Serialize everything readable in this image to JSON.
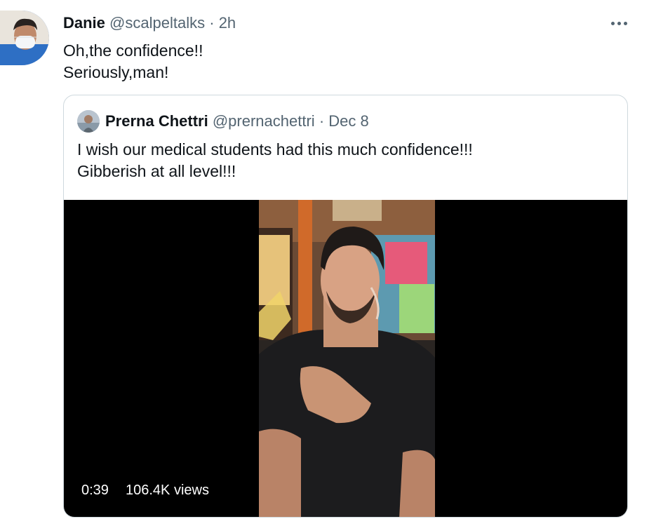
{
  "tweet": {
    "display_name": "Danie",
    "handle": "@scalpeltalks",
    "separator": "·",
    "time": "2h",
    "lines": [
      "Oh,the confidence!!",
      "Seriously,man!"
    ]
  },
  "quoted_tweet": {
    "display_name": "Prerna Chettri",
    "handle": "@prernachettri",
    "separator": "·",
    "date": "Dec 8",
    "lines": [
      "I wish our medical students had this much confidence!!!",
      "Gibberish at all level!!!"
    ]
  },
  "video": {
    "duration": "0:39",
    "views": "106.4K views"
  },
  "icons": {
    "more": "more-horizontal-icon"
  },
  "colors": {
    "text_primary": "#0f1419",
    "text_secondary": "#536471",
    "border": "#cfd9de",
    "video_bg": "#000000"
  }
}
